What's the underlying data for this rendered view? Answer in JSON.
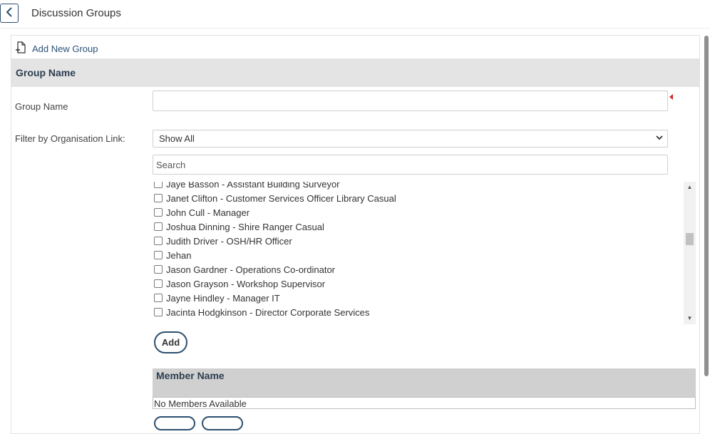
{
  "header": {
    "title": "Discussion Groups",
    "back_icon": "chevron-left-icon"
  },
  "panel": {
    "add_new_group_label": "Add New Group",
    "add_new_group_icon": "document-add-icon",
    "section_header": "Group Name"
  },
  "form": {
    "group_name_label": "Group Name",
    "group_name_value": "",
    "filter_label": "Filter by Organisation Link:",
    "filter_selected": "Show All",
    "search_placeholder": "Search",
    "search_value": ""
  },
  "user_list": {
    "items": [
      {
        "label": "Jaye Basson - Assistant Building Surveyor",
        "checked": false
      },
      {
        "label": "Janet Clifton - Customer Services Officer Library Casual",
        "checked": false
      },
      {
        "label": "John Cull - Manager",
        "checked": false
      },
      {
        "label": "Joshua Dinning - Shire Ranger Casual",
        "checked": false
      },
      {
        "label": "Judith Driver - OSH/HR Officer",
        "checked": false
      },
      {
        "label": "Jehan",
        "checked": false
      },
      {
        "label": "Jason Gardner - Operations Co-ordinator",
        "checked": false
      },
      {
        "label": "Jason Grayson - Workshop Supervisor",
        "checked": false
      },
      {
        "label": "Jayne Hindley - Manager IT",
        "checked": false
      },
      {
        "label": "Jacinta Hodgkinson - Director Corporate Services",
        "checked": false
      }
    ]
  },
  "add_button_label": "Add",
  "members": {
    "header": "Member Name",
    "empty_text": "No Members Available"
  },
  "colors": {
    "accent": "#2c4f6f",
    "link": "#2b5179",
    "header_bg": "#e4e4e4",
    "required": "#d62a2a"
  }
}
